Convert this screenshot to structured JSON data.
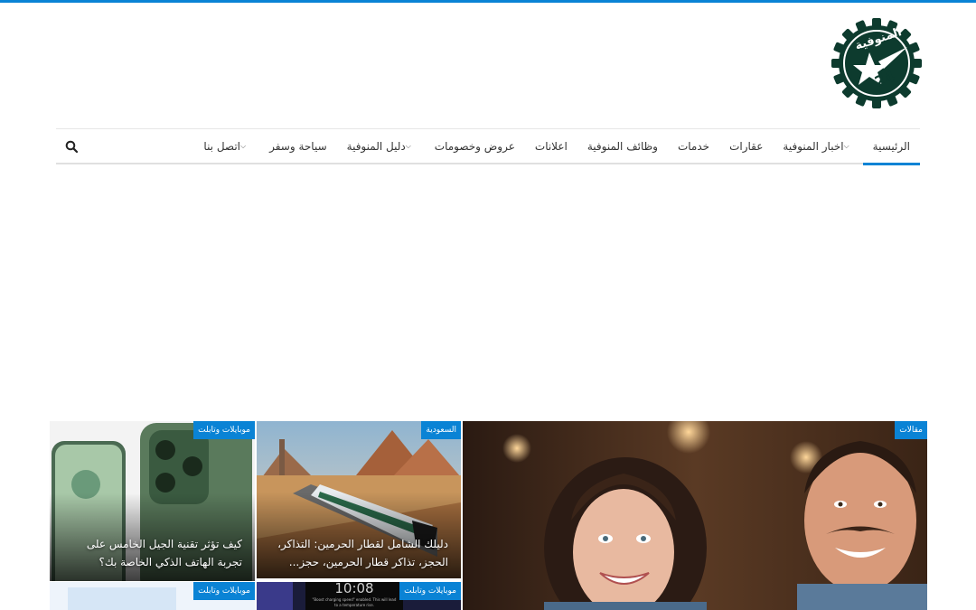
{
  "logo": {
    "word": "المنوفية",
    "number": "24"
  },
  "nav": {
    "items": [
      {
        "label": "الرئيسية",
        "active": true,
        "dropdown": false
      },
      {
        "label": "اخبار المنوفية",
        "active": false,
        "dropdown": true
      },
      {
        "label": "عقارات",
        "active": false,
        "dropdown": false
      },
      {
        "label": "خدمات",
        "active": false,
        "dropdown": false
      },
      {
        "label": "وظائف المنوفية",
        "active": false,
        "dropdown": false
      },
      {
        "label": "اعلانات",
        "active": false,
        "dropdown": false
      },
      {
        "label": "عروض وخصومات",
        "active": false,
        "dropdown": false
      },
      {
        "label": "دليل المنوفية",
        "active": false,
        "dropdown": true
      },
      {
        "label": "سياحة وسفر",
        "active": false,
        "dropdown": false
      },
      {
        "label": "اتصل بنا",
        "active": false,
        "dropdown": true
      }
    ],
    "search_icon": "search-icon",
    "accent": "#0a83d5"
  },
  "posts": {
    "featured": {
      "category": "مقالات"
    },
    "post2": {
      "category": "السعودية",
      "title": "دليلك الشامل لقطار الحرمين: التذاكر، الحجز، تذاكر قطار الحرمين، حجز..."
    },
    "post3": {
      "category": "موبايلات وتابلت",
      "title": "كيف تؤثر تقنية الجيل الخامس على تجربة الهاتف الذكي الخاصة بك؟"
    },
    "post4": {
      "category": "موبايلات وتابلت",
      "screen_time": "10:08",
      "screen_text": "\"Boost charging speed\" enabled. This will lead to a temperature rise."
    },
    "post5": {
      "category": "موبايلات وتابلت"
    }
  }
}
